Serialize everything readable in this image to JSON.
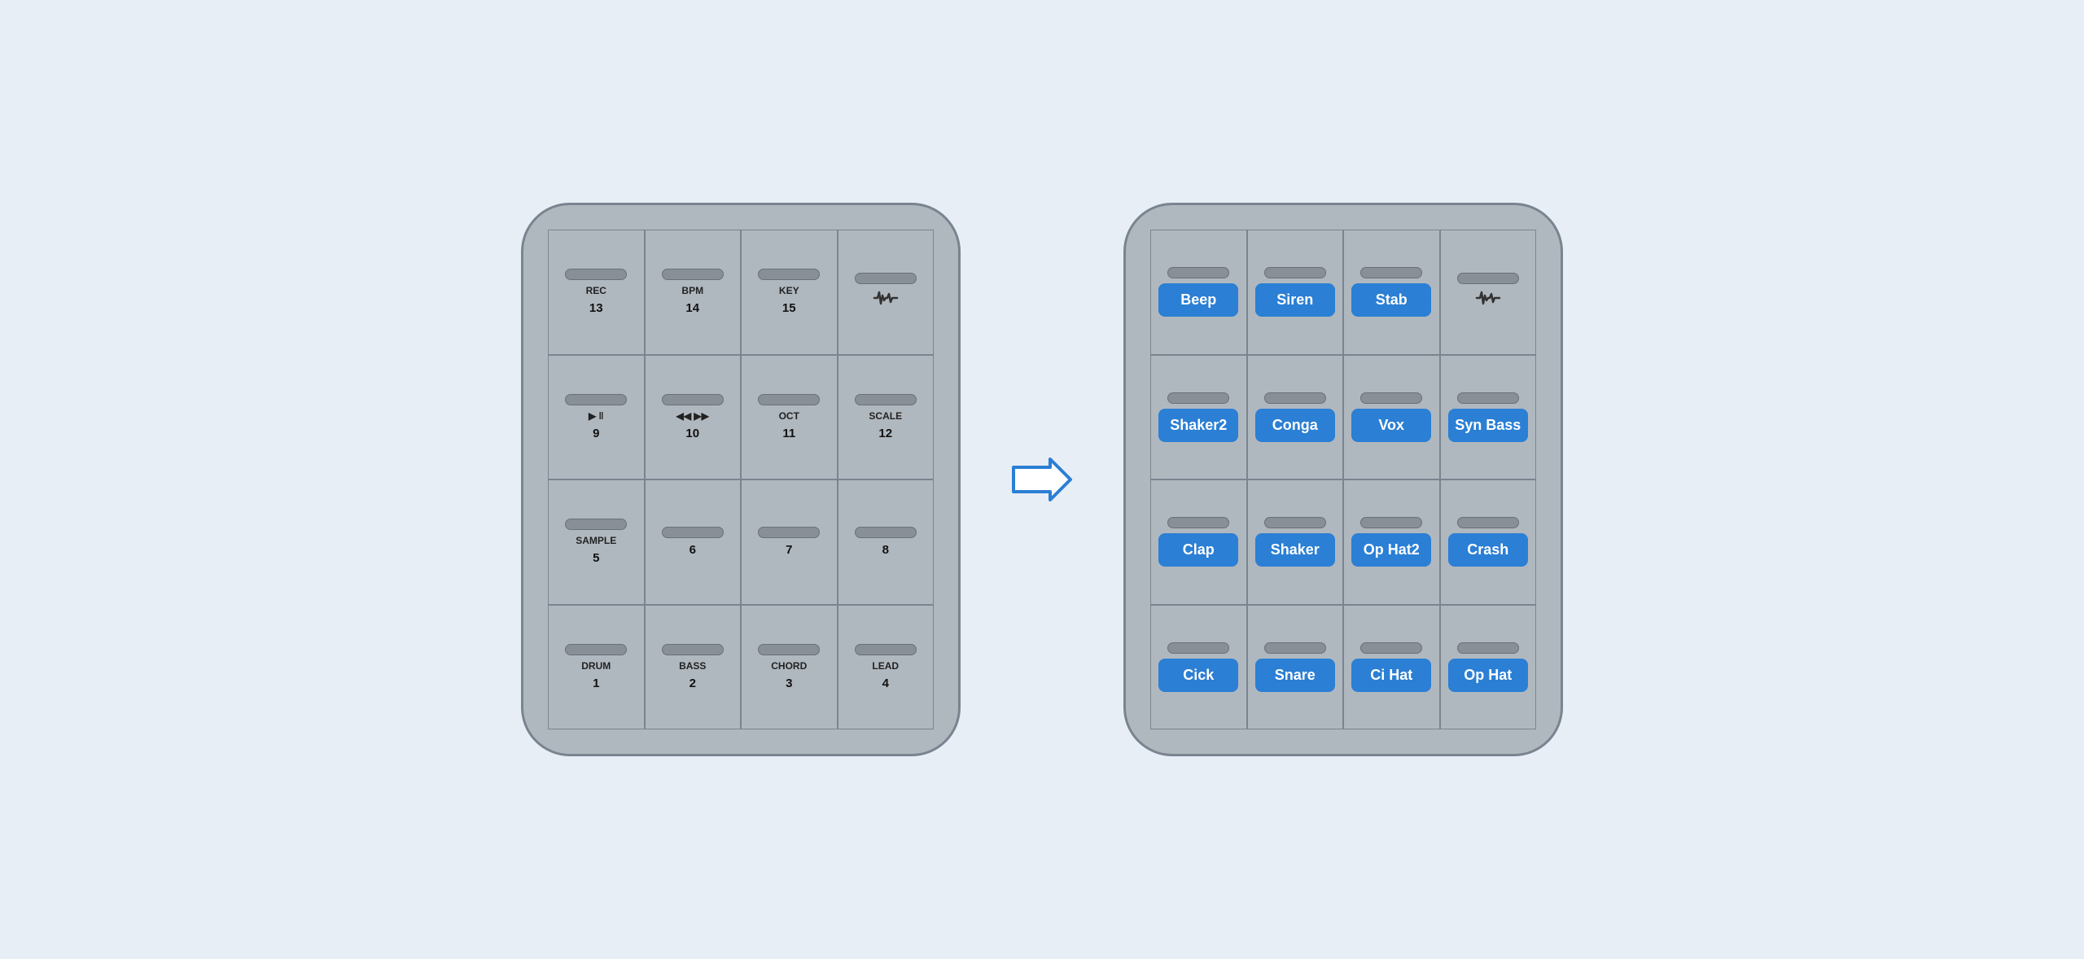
{
  "left_device": {
    "rows": [
      [
        {
          "led": true,
          "label": "REC",
          "number": "13"
        },
        {
          "led": true,
          "label": "BPM",
          "number": "14"
        },
        {
          "led": true,
          "label": "KEY",
          "number": "15"
        },
        {
          "led": true,
          "label": "",
          "number": "",
          "icon": "waveform"
        }
      ],
      [
        {
          "led": true,
          "label": "▶ ‖",
          "number": "9"
        },
        {
          "led": true,
          "label": "◀◀  ▶▶",
          "number": "10"
        },
        {
          "led": true,
          "label": "OCT",
          "number": "11"
        },
        {
          "led": true,
          "label": "SCALE",
          "number": "12"
        }
      ],
      [
        {
          "led": true,
          "label": "SAMPLE",
          "number": "5"
        },
        {
          "led": true,
          "label": "",
          "number": "6"
        },
        {
          "led": true,
          "label": "",
          "number": "7"
        },
        {
          "led": true,
          "label": "",
          "number": "8"
        }
      ],
      [
        {
          "led": true,
          "label": "DRUM",
          "number": "1"
        },
        {
          "led": true,
          "label": "BASS",
          "number": "2"
        },
        {
          "led": true,
          "label": "CHORD",
          "number": "3"
        },
        {
          "led": true,
          "label": "LEAD",
          "number": "4"
        }
      ]
    ]
  },
  "right_device": {
    "rows": [
      [
        {
          "led": true,
          "blue": true,
          "label": "Beep"
        },
        {
          "led": true,
          "blue": true,
          "label": "Siren"
        },
        {
          "led": true,
          "blue": true,
          "label": "Stab"
        },
        {
          "led": true,
          "blue": false,
          "label": "",
          "icon": "waveform"
        }
      ],
      [
        {
          "led": true,
          "blue": true,
          "label": "Shaker2"
        },
        {
          "led": true,
          "blue": true,
          "label": "Conga"
        },
        {
          "led": true,
          "blue": true,
          "label": "Vox"
        },
        {
          "led": true,
          "blue": true,
          "label": "Syn Bass"
        }
      ],
      [
        {
          "led": true,
          "blue": true,
          "label": "Clap"
        },
        {
          "led": true,
          "blue": true,
          "label": "Shaker"
        },
        {
          "led": true,
          "blue": true,
          "label": "Op Hat2"
        },
        {
          "led": true,
          "blue": true,
          "label": "Crash"
        }
      ],
      [
        {
          "led": true,
          "blue": true,
          "label": "Cick"
        },
        {
          "led": true,
          "blue": true,
          "label": "Snare"
        },
        {
          "led": true,
          "blue": true,
          "label": "Ci Hat"
        },
        {
          "led": true,
          "blue": true,
          "label": "Op Hat"
        }
      ]
    ]
  },
  "arrow": "⇒"
}
